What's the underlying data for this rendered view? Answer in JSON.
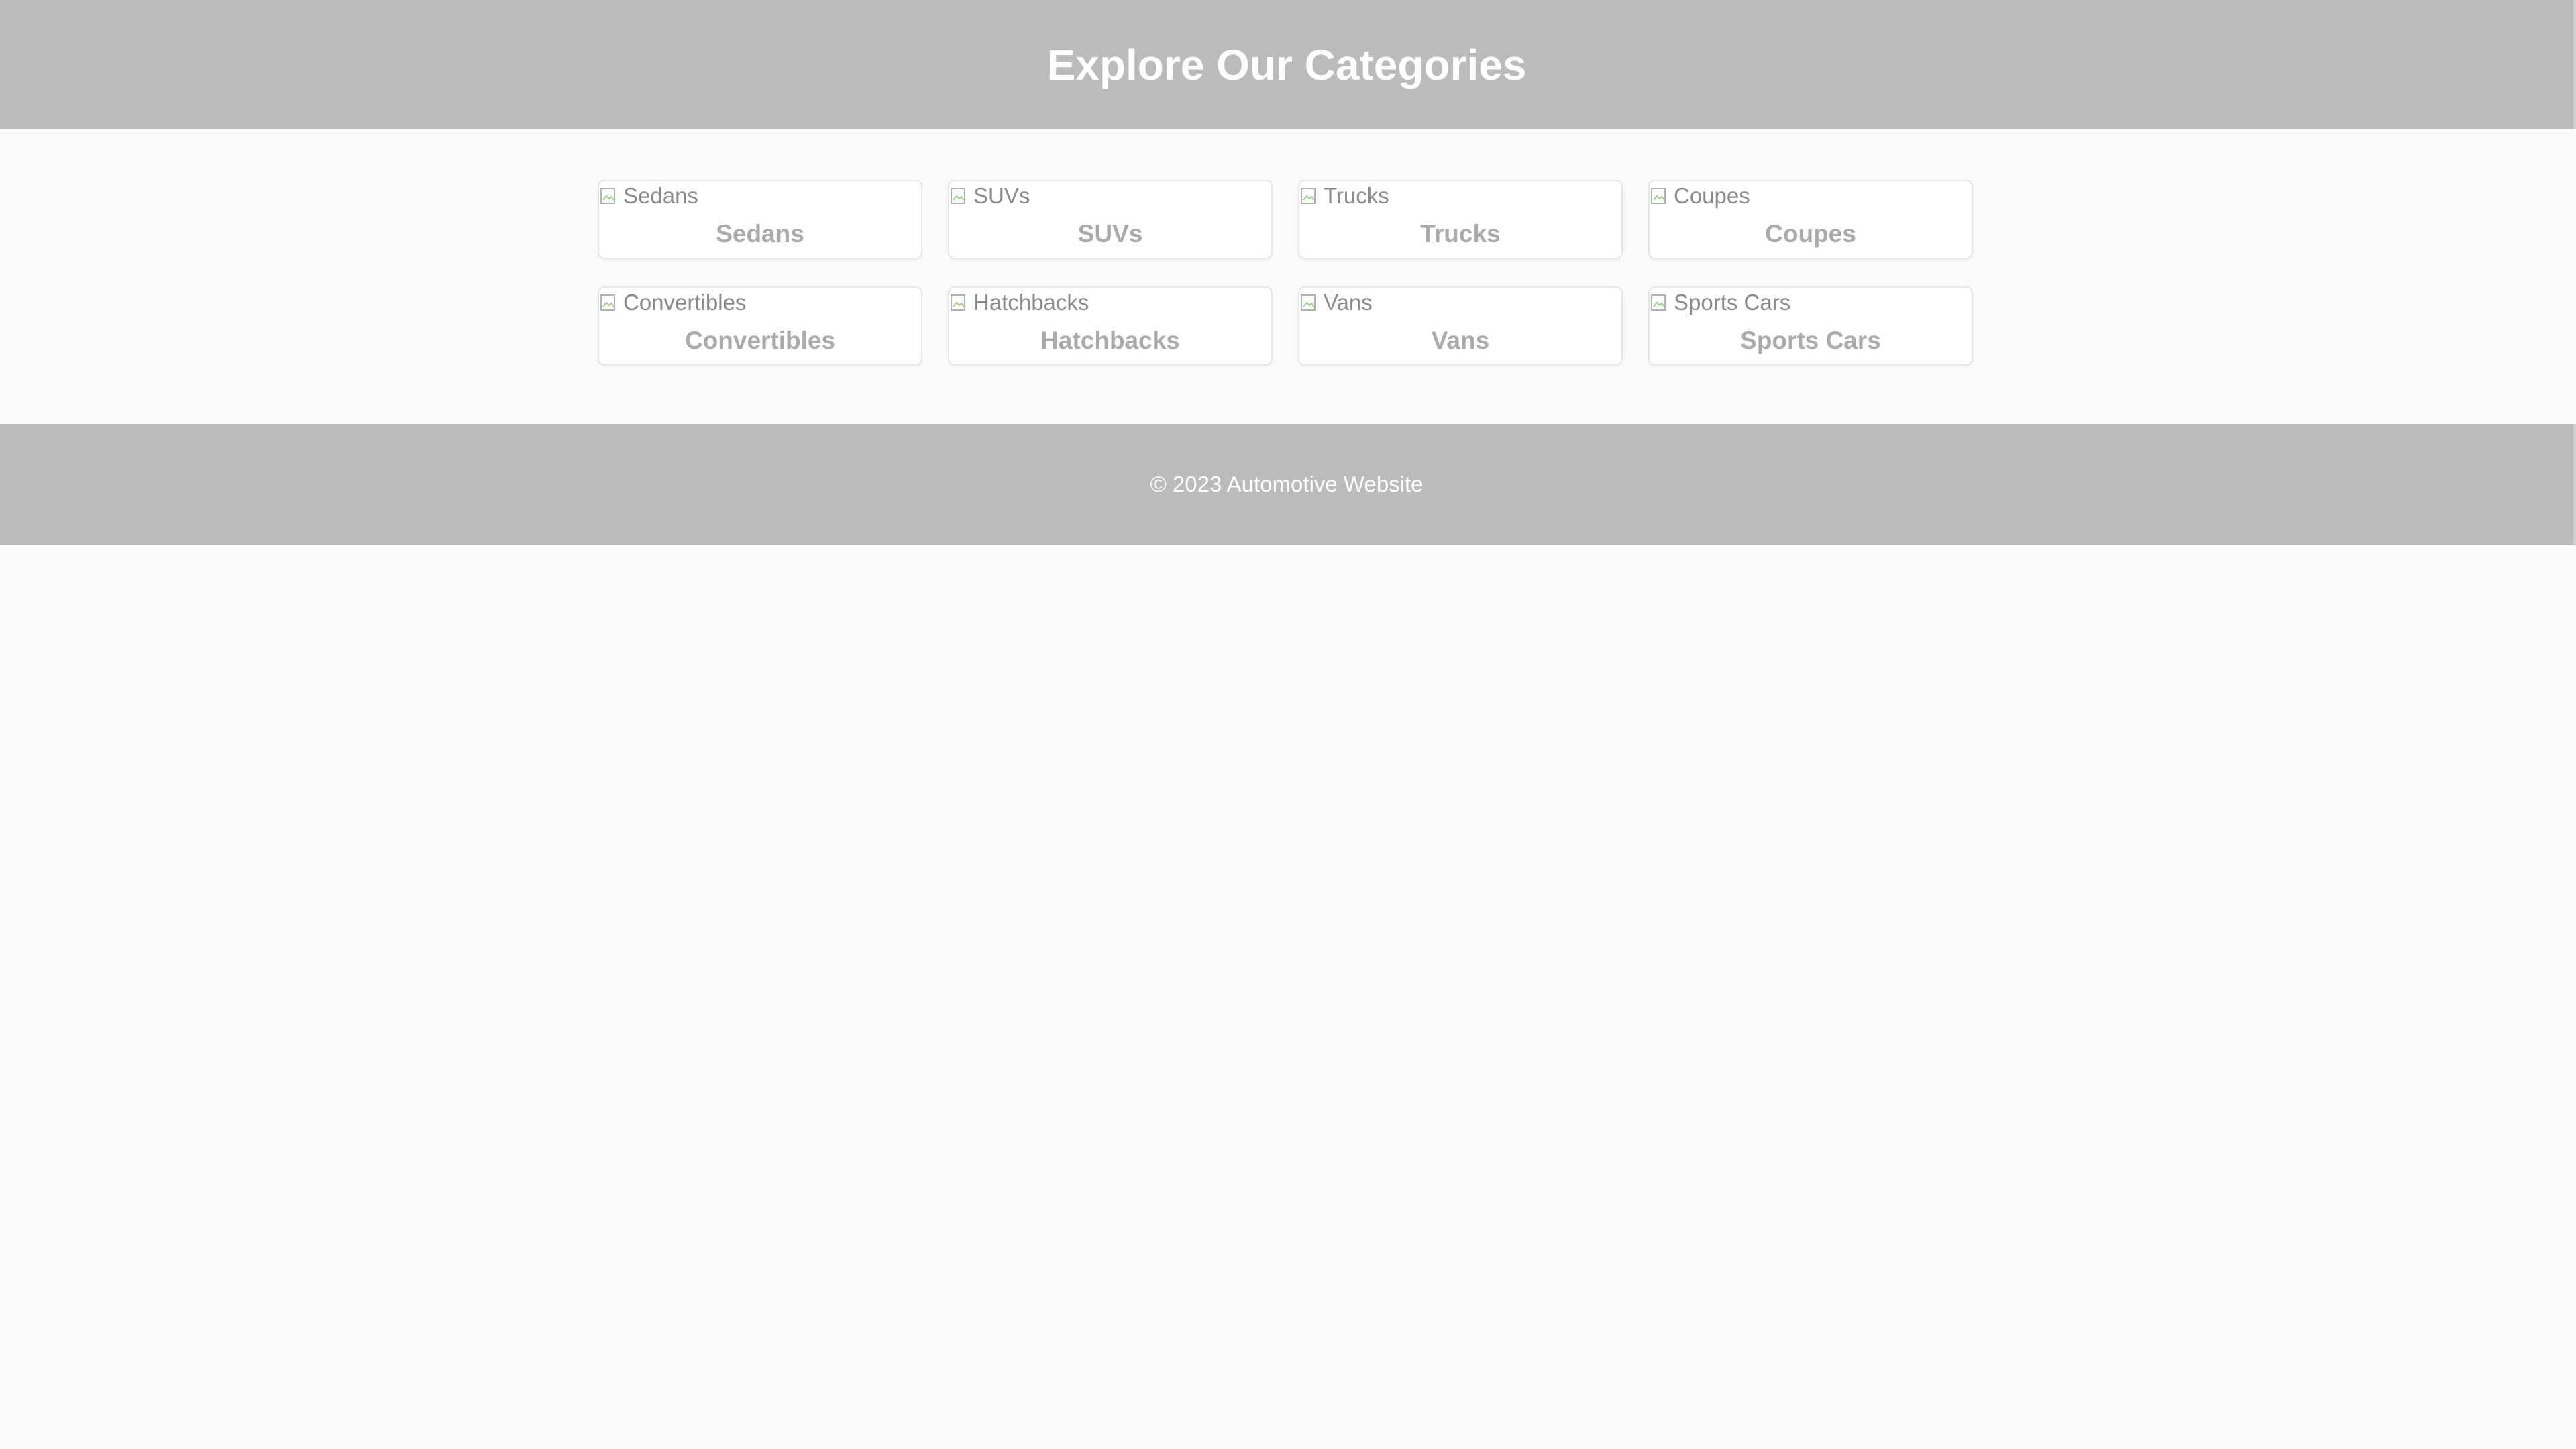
{
  "header": {
    "title": "Explore Our Categories"
  },
  "categories": [
    {
      "name": "Sedans",
      "img_alt": "Sedans"
    },
    {
      "name": "SUVs",
      "img_alt": "SUVs"
    },
    {
      "name": "Trucks",
      "img_alt": "Trucks"
    },
    {
      "name": "Coupes",
      "img_alt": "Coupes"
    },
    {
      "name": "Convertibles",
      "img_alt": "Convertibles"
    },
    {
      "name": "Hatchbacks",
      "img_alt": "Hatchbacks"
    },
    {
      "name": "Vans",
      "img_alt": "Vans"
    },
    {
      "name": "Sports Cars",
      "img_alt": "Sports Cars"
    }
  ],
  "footer": {
    "copyright": "© 2023 Automotive Website"
  },
  "colors": {
    "header_bg": "#bbbbbb",
    "footer_bg": "#bbbbbb",
    "page_bg": "#fafafa",
    "card_bg": "#ffffff",
    "label_text": "#aaaaaa"
  },
  "icons": {
    "image_placeholder": "broken-image-icon"
  }
}
